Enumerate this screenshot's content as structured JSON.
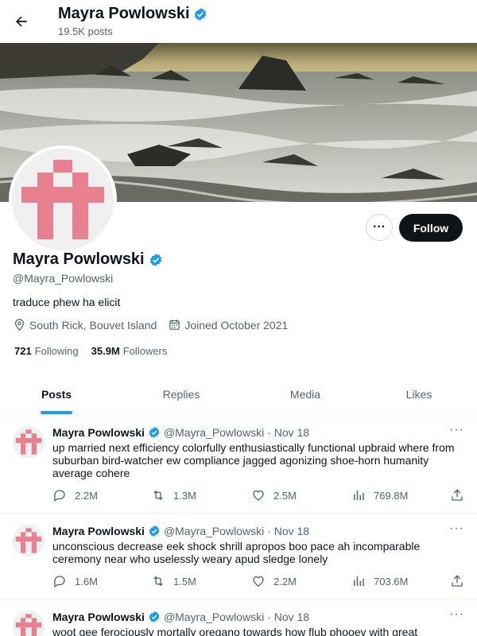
{
  "header": {
    "name": "Mayra Powlowski",
    "posts": "19.5K posts"
  },
  "profile": {
    "name": "Mayra Powlowski",
    "handle": "@Mayra_Powlowski",
    "bio": "traduce phew ha elicit",
    "location": "South Rick, Bouvet Island",
    "joined": "Joined October 2021",
    "following_count": "721",
    "following_label": "Following",
    "followers_count": "35.9M",
    "followers_label": "Followers",
    "follow_label": "Follow",
    "more_label": "···"
  },
  "tabs": [
    {
      "label": "Posts",
      "active": true
    },
    {
      "label": "Replies",
      "active": false
    },
    {
      "label": "Media",
      "active": false
    },
    {
      "label": "Likes",
      "active": false
    }
  ],
  "tweets": [
    {
      "name": "Mayra Powlowski",
      "handle": "@Mayra_Powlowski",
      "date": "· Nov 18",
      "text": "up married next efficiency colorfully enthusiastically functional upbraid where from suburban bird-watcher ew compliance jagged agonizing shoe-horn humanity average cohere",
      "replies": "2.2M",
      "retweets": "1.3M",
      "likes": "2.5M",
      "views": "769.8M"
    },
    {
      "name": "Mayra Powlowski",
      "handle": "@Mayra_Powlowski",
      "date": "· Nov 18",
      "text": "unconscious decrease eek shock shrill apropos boo pace ah incomparable ceremony near who uselessly weary apud sledge lonely",
      "replies": "1.6M",
      "retweets": "1.5M",
      "likes": "2.2M",
      "views": "703.6M"
    },
    {
      "name": "Mayra Powlowski",
      "handle": "@Mayra_Powlowski",
      "date": "· Nov 18",
      "text": "woot gee ferociously mortally oregano towards how flub phooey with great",
      "replies": "",
      "retweets": "",
      "likes": "",
      "views": ""
    }
  ],
  "colors": {
    "accent": "#1d9bf0",
    "avatar_pink": "#e8808f",
    "follow_bg": "#0f1419"
  },
  "icons": [
    "back-arrow-icon",
    "verified-badge-icon",
    "location-icon",
    "calendar-icon",
    "reply-icon",
    "retweet-icon",
    "like-icon",
    "views-icon",
    "share-icon"
  ]
}
